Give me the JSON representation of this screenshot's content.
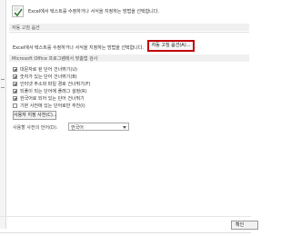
{
  "intro": {
    "text": "Excel에서 텍스트를 수정하거나 서식을 지정하는 방법을 선택합니다."
  },
  "autocorrect_section": {
    "header": "자동 고침 옵션",
    "description": "Excel에서 텍스트를 수정하거나 서식을 지정하는 방법을 선택합니다.",
    "button_label": "자동 고침 옵션(A)..."
  },
  "office_section": {
    "header": "Microsoft Office 프로그램에서 맞춤법 검사",
    "checkboxes": [
      {
        "label": "대문자로 된 단어 건너뛰기(U)",
        "checked": true
      },
      {
        "label": "숫자가 있는 단어 건너뛰기(B)",
        "checked": true
      },
      {
        "label": "인터넷 주소와 파일 경로 건너뛰기(F)",
        "checked": true
      },
      {
        "label": "되풀이 되는 단어에 플래그 설정(R)",
        "checked": true
      },
      {
        "label": "한국어로 되어 있는 단어 건너뛰기",
        "checked": true
      },
      {
        "label": "기본 사전에 있는 단어로만 추천(I)",
        "checked": false
      }
    ],
    "dictionary_button": "사용자 지정 사전(C)...",
    "language_label": "사용할 사전의 언어(D):",
    "language_value": "한국어"
  },
  "footer": {
    "ok_label": "확인"
  },
  "colors": {
    "highlight_border": "#c00000",
    "section_header_bg": "#f0f0f0"
  }
}
